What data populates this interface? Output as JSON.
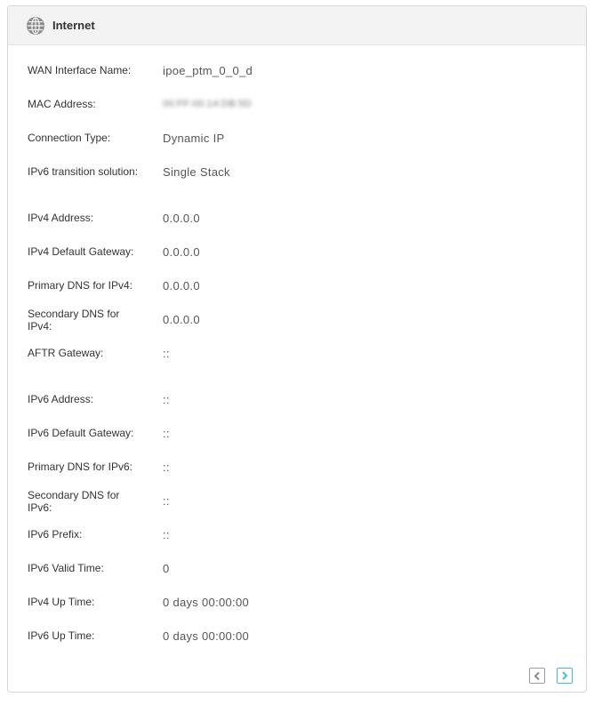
{
  "panel": {
    "title": "Internet",
    "icon": "globe-icon"
  },
  "rows": [
    {
      "label": "WAN Interface Name:",
      "value": "ipoe_ptm_0_0_d"
    },
    {
      "label": "MAC Address:",
      "value": "00:FF:00:14:DB:5D"
    },
    {
      "label": "Connection Type:",
      "value": "Dynamic IP"
    },
    {
      "label": "IPv6 transition solution:",
      "value": "Single Stack"
    },
    {
      "label": "IPv4 Address:",
      "value": "0.0.0.0"
    },
    {
      "label": "IPv4 Default Gateway:",
      "value": "0.0.0.0"
    },
    {
      "label": "Primary DNS for IPv4:",
      "value": "0.0.0.0"
    },
    {
      "label": "Secondary DNS for IPv4:",
      "value": "0.0.0.0"
    },
    {
      "label": "AFTR Gateway:",
      "value": "::"
    },
    {
      "label": "IPv6 Address:",
      "value": "::"
    },
    {
      "label": "IPv6 Default Gateway:",
      "value": "::"
    },
    {
      "label": "Primary DNS for IPv6:",
      "value": "::"
    },
    {
      "label": "Secondary DNS for IPv6:",
      "value": "::"
    },
    {
      "label": "IPv6 Prefix:",
      "value": "::"
    },
    {
      "label": "IPv6 Valid Time:",
      "value": "0"
    },
    {
      "label": "IPv4 Up Time:",
      "value": "0 days 00:00:00"
    },
    {
      "label": "IPv6 Up Time:",
      "value": "0 days 00:00:00"
    }
  ],
  "nav": {
    "prev_icon": "chevron-left-icon",
    "next_icon": "chevron-right-icon",
    "accent_color": "#4bb7d0"
  }
}
